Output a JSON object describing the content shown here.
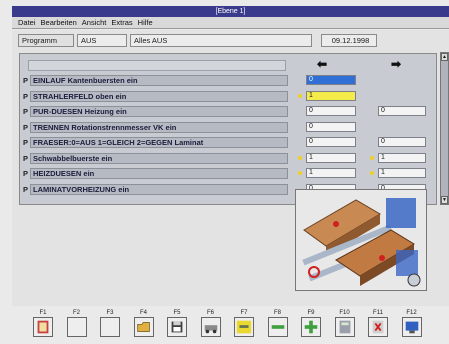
{
  "window": {
    "title": "[Ebene 1]"
  },
  "menu": [
    "Datei",
    "Bearbeiten",
    "Ansicht",
    "Extras",
    "Hilfe"
  ],
  "header": {
    "program_label": "Programm",
    "program_value": "AUS",
    "program_desc": "Alles AUS",
    "date": "09.12.1998"
  },
  "controls": {
    "prefix": "P",
    "rows": [
      {
        "label": "EINLAUF Kantenbuersten ein",
        "val1": "0",
        "val2": "",
        "val1_style": "blue",
        "val2_style": "none",
        "dot1": ""
      },
      {
        "label": "STRAHLERFELD oben ein",
        "val1": "1",
        "val2": "",
        "val1_style": "yellow",
        "val2_style": "none",
        "dot1": "yellow"
      },
      {
        "label": "PUR-DUESEN Heizung ein",
        "val1": "0",
        "val2": "0",
        "val1_style": "plain",
        "val2_style": "plain",
        "dot1": ""
      },
      {
        "label": "TRENNEN Rotationstrennmesser VK ein",
        "val1": "0",
        "val2": "",
        "val1_style": "plain",
        "val2_style": "none",
        "dot1": ""
      },
      {
        "label": "FRAESER:0=AUS 1=GLEICH 2=GEGEN Laminat",
        "val1": "0",
        "val2": "0",
        "val1_style": "plain",
        "val2_style": "plain",
        "dot1": ""
      },
      {
        "label": "Schwabbelbuerste ein",
        "val1": "1",
        "val2": "1",
        "val1_style": "plain",
        "val2_style": "plain",
        "dot1": "yellow",
        "dot2": "yellow"
      },
      {
        "label": "HEIZDUESEN ein",
        "val1": "1",
        "val2": "1",
        "val1_style": "plain",
        "val2_style": "plain",
        "dot1": "yellow",
        "dot2": "yellow"
      },
      {
        "label": "LAMINATVORHEIZUNG ein",
        "val1": "0",
        "val2": "0",
        "val1_style": "plain",
        "val2_style": "plain",
        "dot1": ""
      }
    ]
  },
  "arrows": {
    "left": "⬅",
    "right": "➡"
  },
  "function_keys": [
    {
      "label": "F1",
      "icon": "book-icon"
    },
    {
      "label": "F2",
      "icon": "blank-icon"
    },
    {
      "label": "F3",
      "icon": "blank-icon"
    },
    {
      "label": "F4",
      "icon": "open-folder-icon"
    },
    {
      "label": "F5",
      "icon": "save-disk-icon"
    },
    {
      "label": "F6",
      "icon": "machine-settings-icon"
    },
    {
      "label": "F7",
      "icon": "yellow-adjust-icon"
    },
    {
      "label": "F8",
      "icon": "minus-icon"
    },
    {
      "label": "F9",
      "icon": "plus-icon"
    },
    {
      "label": "F10",
      "icon": "calculator-icon"
    },
    {
      "label": "F11",
      "icon": "exit-icon"
    },
    {
      "label": "F12",
      "icon": "monitor-icon"
    }
  ],
  "colors": {
    "title_bg": "#3a3a8c",
    "active_blue": "#2f6fd6",
    "active_yellow": "#f4ea4a",
    "panel_bg": "#c8ccd2"
  }
}
